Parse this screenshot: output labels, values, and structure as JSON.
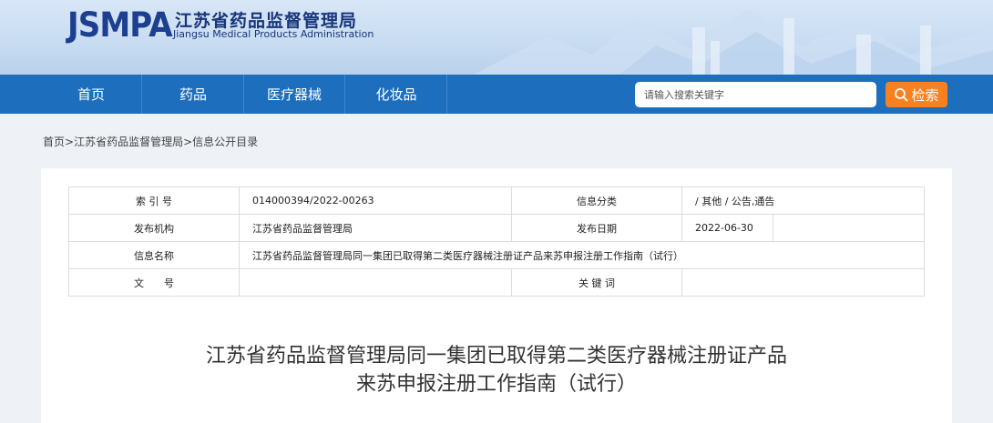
{
  "header": {
    "logo": "JSMPA",
    "org_cn": "江苏省药品监督管理局",
    "org_en": "Jiangsu Medical Products Administration"
  },
  "nav": {
    "items": [
      "首页",
      "药品",
      "医疗器械",
      "化妆品"
    ]
  },
  "search": {
    "placeholder": "请输入搜索关键字",
    "button_label": "检索",
    "icon": "search-icon"
  },
  "breadcrumb": {
    "items": [
      "首页",
      "江苏省药品监督管理局",
      "信息公开目录"
    ],
    "separator": ">"
  },
  "info": {
    "index_label": "索 引 号",
    "index_value": "014000394/2022-00263",
    "category_label": "信息分类",
    "category_value": "/ 其他 / 公告,通告",
    "publisher_label": "发布机构",
    "publisher_value": "江苏省药品监督管理局",
    "date_label": "发布日期",
    "date_value": "2022-06-30",
    "name_label": "信息名称",
    "name_value": "江苏省药品监督管理局同一集团已取得第二类医疗器械注册证产品来苏申报注册工作指南（试行）",
    "docno_label": "文　　号",
    "docno_value": "",
    "keywords_label": "关 键 词",
    "keywords_value": ""
  },
  "article": {
    "title_line1": "江苏省药品监督管理局同一集团已取得第二类医疗器械注册证产品",
    "title_line2": "来苏申报注册工作指南（试行）"
  },
  "colors": {
    "nav": "#1d6fbe",
    "search_button": "#f7801f",
    "logo": "#1c3f8f"
  }
}
